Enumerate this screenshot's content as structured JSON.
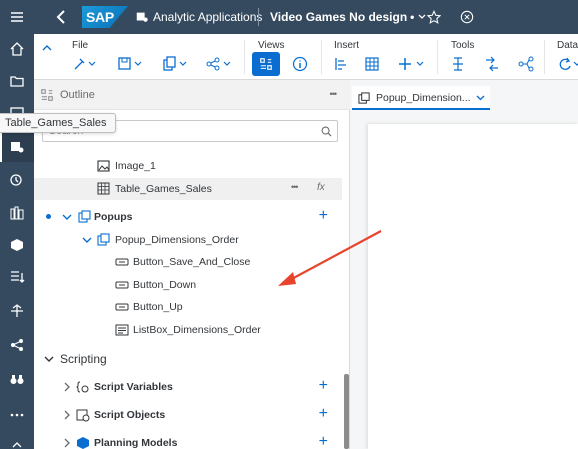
{
  "shell": {
    "logo_text": "SAP",
    "app_name": "Analytic Applications",
    "doc_name": "Video Games No design",
    "doc_suffix": "•"
  },
  "toolbar": {
    "groups": {
      "file": "File",
      "views": "Views",
      "insert": "Insert",
      "tools": "Tools",
      "data": "Data"
    }
  },
  "outline": {
    "title": "Outline",
    "search_placeholder": "Search",
    "tooltip": "Table_Games_Sales",
    "items": {
      "image": "Image_1",
      "table": "Table_Games_Sales",
      "table_fx": "fx",
      "popups": "Popups",
      "popup_dim": "Popup_Dimensions_Order",
      "btn_save": "Button_Save_And_Close",
      "btn_down": "Button_Down",
      "btn_up": "Button_Up",
      "listbox": "ListBox_Dimensions_Order",
      "scripting": "Scripting",
      "script_vars": "Script Variables",
      "script_objs": "Script Objects",
      "planning": "Planning Models"
    },
    "more": "•••"
  },
  "canvas": {
    "tab_label": "Popup_Dimension..."
  },
  "colors": {
    "shell_bg": "#354a5f",
    "accent": "#0a6ed1",
    "arrow": "#e8442b"
  }
}
